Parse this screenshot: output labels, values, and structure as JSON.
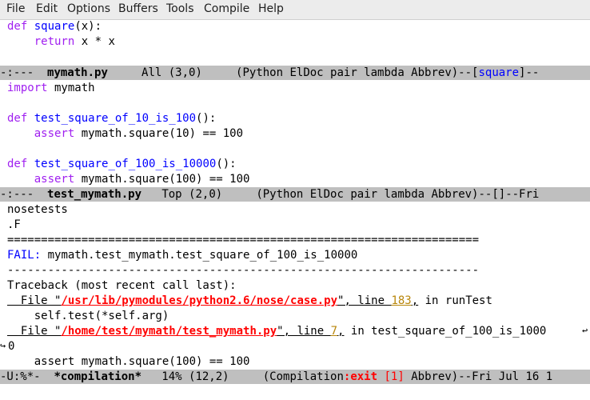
{
  "menu": [
    "File",
    "Edit",
    "Options",
    "Buffers",
    "Tools",
    "Compile",
    "Help"
  ],
  "buffer1": {
    "lines": [
      {
        "kw": "def",
        "name": "square",
        "rest": "(x):"
      },
      {
        "indent": "    ",
        "kw": "return",
        "rest": " x * x"
      }
    ]
  },
  "modeline1": {
    "status": "-:---  ",
    "buffer": "mymath.py",
    "position": "     All (3,0)     ",
    "modes": "(Python ElDoc pair lambda Abbrev)--[",
    "func": "square",
    "tail": "]--"
  },
  "buffer2": {
    "import_kw": "import",
    "import_rest": " mymath",
    "test1_kw": "def",
    "test1_name": "test_square_of_10_is_100",
    "test1_rest": "():",
    "test1_body_kw": "assert",
    "test1_body_rest": " mymath.square(10) == 100",
    "test2_kw": "def",
    "test2_name": "test_square_of_100_is_10000",
    "test2_rest": "():",
    "test2_body_kw": "assert",
    "test2_body_rest": " mymath.square(100) == 100"
  },
  "modeline2": {
    "status": "-:---  ",
    "buffer": "test_mymath.py",
    "position": "   Top (2,0)     ",
    "modes": "(Python ElDoc pair lambda Abbrev)--[]--Fri"
  },
  "compilation": {
    "command": "nosetests",
    "dots": ".F",
    "separator_eq": "======================================================================",
    "fail_label": "FAIL:",
    "fail_rest": " mymath.test_mymath.test_square_of_100_is_10000",
    "separator_dash": "----------------------------------------------------------------------",
    "traceback": "Traceback (most recent call last):",
    "frame1_prefix": "  File \"",
    "frame1_path": "/usr/lib/pymodules/python2.6/nose/case.py",
    "frame1_mid": "\", line ",
    "frame1_line": "183",
    "frame1_comma": ",",
    "frame1_suffix": " in runTest",
    "frame1_code": "    self.test(*self.arg)",
    "frame2_prefix": "  File \"",
    "frame2_path": "/home/test/mymath/test_mymath.py",
    "frame2_mid": "\", line ",
    "frame2_line": "7",
    "frame2_comma": ",",
    "frame2_suffix": " in test_square_of_100_is_1000",
    "wrap_continuation": "0",
    "assert_line": "    assert mymath.square(100) == 100"
  },
  "modeline3": {
    "status": "-U:%*-  ",
    "buffer": "*compilation*",
    "position": "   14% (12,2)     ",
    "modes_open": "(Compilation",
    "exit_label": ":exit",
    "exit_code": "[1]",
    "modes_close": " Abbrev)--Fri Jul 16 1"
  }
}
